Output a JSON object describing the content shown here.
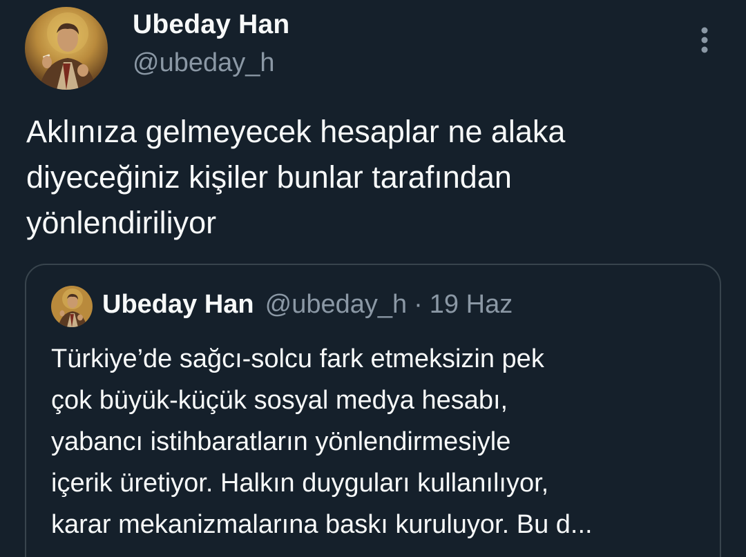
{
  "tweet": {
    "author_name": "Ubeday Han",
    "author_handle": "@ubeday_h",
    "text": "Aklınıza gelmeyecek hesaplar ne alaka\ndiyeceğiniz kişiler bunlar tarafından\nyönlendiriliyor",
    "more_icon": "more-vertical-icon"
  },
  "quote": {
    "author_name": "Ubeday Han",
    "author_handle": "@ubeday_h",
    "separator": "·",
    "date": "19 Haz",
    "text": "Türkiye’de sağcı-solcu fark etmeksizin pek\nçok büyük-küçük sosyal medya hesabı,\nyabancı istihbaratların yönlendirmesiyle\niçerik üretiyor. Halkın duyguları kullanılıyor,\nkarar mekanizmalarına baskı kuruluyor. Bu d..."
  },
  "colors": {
    "background": "#15202b",
    "primary_text": "#f7f9f9",
    "secondary_text": "#8b98a5",
    "border": "#38444d"
  }
}
